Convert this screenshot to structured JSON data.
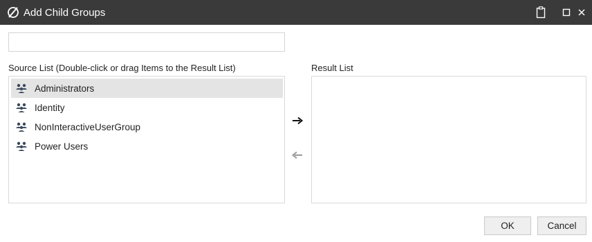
{
  "dialog": {
    "title": "Add Child Groups"
  },
  "search": {
    "value": "",
    "placeholder": ""
  },
  "source_list": {
    "label": "Source List (Double-click or drag Items to the Result List)",
    "items": [
      {
        "label": "Administrators",
        "icon": "group-icon",
        "selected": true
      },
      {
        "label": "Identity",
        "icon": "group-icon",
        "selected": false
      },
      {
        "label": "NonInteractiveUserGroup",
        "icon": "group-icon",
        "selected": false
      },
      {
        "label": "Power Users",
        "icon": "group-icon",
        "selected": false
      }
    ]
  },
  "result_list": {
    "label": "Result List",
    "items": []
  },
  "buttons": {
    "ok": "OK",
    "cancel": "Cancel"
  },
  "colors": {
    "titlebar": "#3a3a3a",
    "selected_row": "#e4e4e4",
    "group_icon": "#3a4a5c",
    "arrow_active": "#111111",
    "arrow_disabled": "#9a9a9a"
  }
}
